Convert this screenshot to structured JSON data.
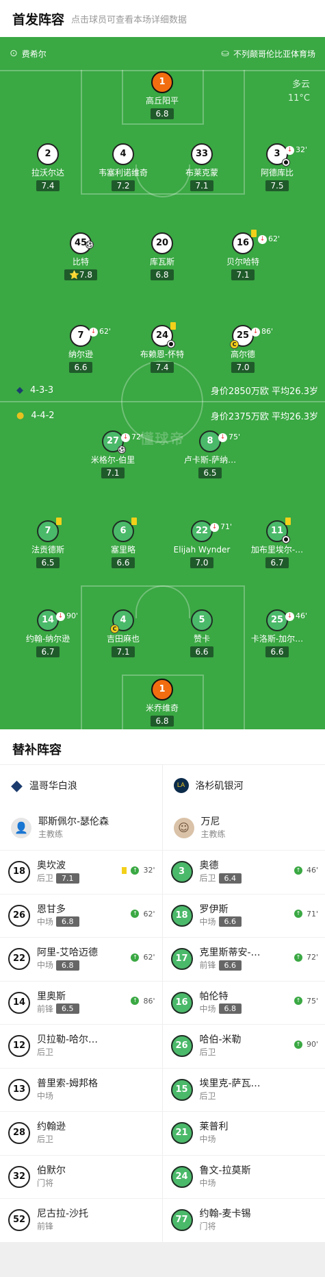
{
  "header": {
    "title": "首发阵容",
    "subtitle": "点击球员可查看本场详细数据"
  },
  "match_info": {
    "referee": "费希尔",
    "venue": "不列颠哥伦比亚体育场",
    "weather": "多云",
    "temperature": "11°C"
  },
  "home": {
    "formation": "4-3-3",
    "value": "身价2850万欧 平均26.3岁"
  },
  "away": {
    "formation": "4-4-2",
    "value": "身价2375万欧 平均26.3岁"
  },
  "watermark": "懂球帝",
  "home_players": [
    {
      "num": "1",
      "name": "高丘阳平",
      "rating": "6.8"
    },
    {
      "num": "2",
      "name": "拉沃尔达",
      "rating": "7.4"
    },
    {
      "num": "4",
      "name": "韦塞利诺维奇",
      "rating": "7.2"
    },
    {
      "num": "33",
      "name": "布莱克蒙",
      "rating": "7.1"
    },
    {
      "num": "3",
      "name": "阿德库比",
      "rating": "7.5",
      "sub": "32'"
    },
    {
      "num": "45",
      "name": "比特",
      "rating": "7.8"
    },
    {
      "num": "20",
      "name": "库瓦斯",
      "rating": "6.8"
    },
    {
      "num": "16",
      "name": "贝尔哈特",
      "rating": "7.1",
      "sub": "62'"
    },
    {
      "num": "7",
      "name": "纳尔逊",
      "rating": "6.6",
      "sub": "62'"
    },
    {
      "num": "24",
      "name": "布赖恩-怀特",
      "rating": "7.4"
    },
    {
      "num": "25",
      "name": "高尔德",
      "rating": "7.0",
      "sub": "86'"
    }
  ],
  "away_players": [
    {
      "num": "27",
      "name": "米格尔-伯里",
      "rating": "7.1",
      "sub": "72'"
    },
    {
      "num": "8",
      "name": "卢卡斯-萨纳…",
      "rating": "6.5",
      "sub": "75'"
    },
    {
      "num": "7",
      "name": "法贡德斯",
      "rating": "6.5"
    },
    {
      "num": "6",
      "name": "塞里略",
      "rating": "6.6"
    },
    {
      "num": "22",
      "name": "Elijah Wynder",
      "rating": "7.0",
      "sub": "71'"
    },
    {
      "num": "11",
      "name": "加布里埃尔-…",
      "rating": "6.7"
    },
    {
      "num": "14",
      "name": "约翰-纳尔逊",
      "rating": "6.7",
      "sub": "90'"
    },
    {
      "num": "4",
      "name": "吉田麻也",
      "rating": "7.1"
    },
    {
      "num": "5",
      "name": "赞卡",
      "rating": "6.6"
    },
    {
      "num": "25",
      "name": "卡洛斯-加尔…",
      "rating": "6.6",
      "sub": "46'"
    },
    {
      "num": "1",
      "name": "米乔维奇",
      "rating": "6.8"
    }
  ],
  "subs_title": "替补阵容",
  "home_subs": {
    "team": "温哥华白浪",
    "coach": "耶斯佩尔-瑟伦森",
    "coach_role": "主教练",
    "players": [
      {
        "num": "18",
        "name": "奥坎波",
        "pos": "后卫",
        "rating": "7.1",
        "time": "32'"
      },
      {
        "num": "26",
        "name": "恩甘多",
        "pos": "中场",
        "rating": "6.8",
        "time": "62'"
      },
      {
        "num": "22",
        "name": "阿里-艾哈迈德",
        "pos": "中场",
        "rating": "6.8",
        "time": "62'"
      },
      {
        "num": "14",
        "name": "里奥斯",
        "pos": "前锋",
        "rating": "6.5",
        "time": "86'"
      },
      {
        "num": "12",
        "name": "贝拉勒-哈尔…",
        "pos": "后卫"
      },
      {
        "num": "13",
        "name": "普里索-姆邦格",
        "pos": "中场"
      },
      {
        "num": "28",
        "name": "约翰逊",
        "pos": "后卫"
      },
      {
        "num": "32",
        "name": "伯默尔",
        "pos": "门将"
      },
      {
        "num": "52",
        "name": "尼古拉-沙托",
        "pos": "前锋"
      }
    ]
  },
  "away_subs": {
    "team": "洛杉矶银河",
    "coach": "万尼",
    "coach_role": "主教练",
    "players": [
      {
        "num": "3",
        "name": "奥德",
        "pos": "后卫",
        "rating": "6.4",
        "time": "46'"
      },
      {
        "num": "18",
        "name": "罗伊斯",
        "pos": "中场",
        "rating": "6.6",
        "time": "71'"
      },
      {
        "num": "17",
        "name": "克里斯蒂安-…",
        "pos": "前锋",
        "rating": "6.6",
        "time": "72'"
      },
      {
        "num": "16",
        "name": "帕伦特",
        "pos": "中场",
        "rating": "6.8",
        "time": "75'"
      },
      {
        "num": "26",
        "name": "哈伯-米勒",
        "pos": "后卫",
        "time": "90'"
      },
      {
        "num": "15",
        "name": "埃里克-萨瓦…",
        "pos": "后卫"
      },
      {
        "num": "21",
        "name": "莱普利",
        "pos": "中场"
      },
      {
        "num": "24",
        "name": "鲁文-拉莫斯",
        "pos": "中场"
      },
      {
        "num": "77",
        "name": "约翰-麦卡锡",
        "pos": "门将"
      }
    ]
  }
}
